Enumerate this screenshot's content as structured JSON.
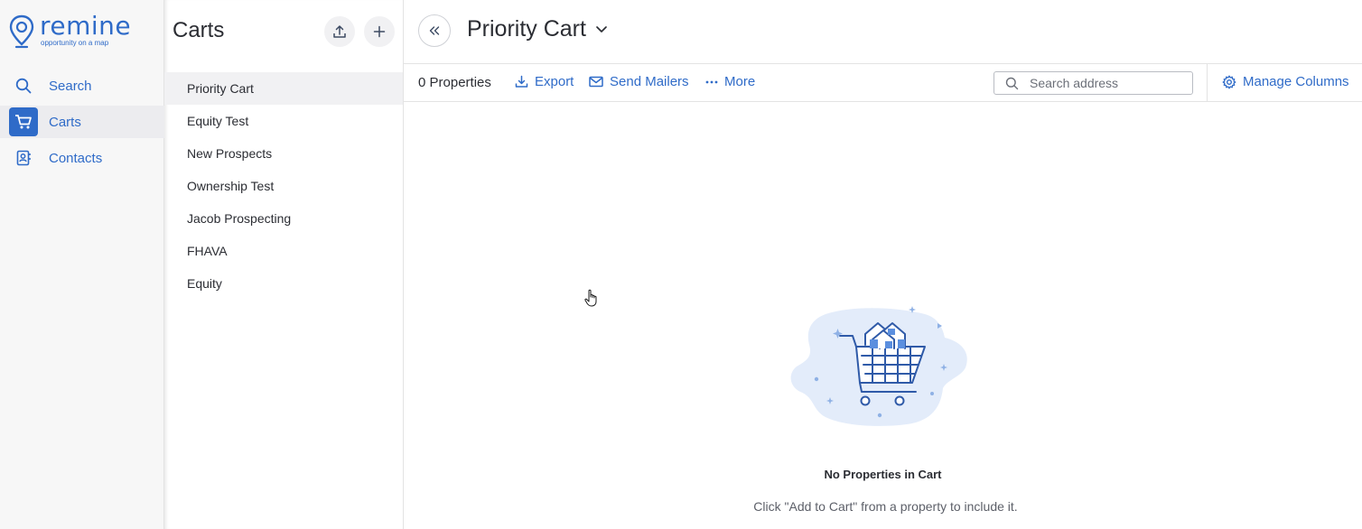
{
  "brand": {
    "name": "remine",
    "tagline": "opportunity on a map",
    "accent": "#2f6bc8"
  },
  "nav": {
    "items": [
      {
        "label": "Search",
        "icon": "search-icon",
        "active": false
      },
      {
        "label": "Carts",
        "icon": "cart-icon",
        "active": true
      },
      {
        "label": "Contacts",
        "icon": "contacts-icon",
        "active": false
      }
    ]
  },
  "carts": {
    "title": "Carts",
    "items": [
      "Priority Cart",
      "Equity Test",
      "New Prospects",
      "Ownership Test",
      "Jacob Prospecting",
      "FHAVA",
      "Equity"
    ],
    "selected": "Priority Cart"
  },
  "main": {
    "title": "Priority Cart",
    "property_count": "0 Properties",
    "actions": {
      "export": "Export",
      "send_mailers": "Send Mailers",
      "more": "More",
      "manage_columns": "Manage Columns"
    },
    "search": {
      "placeholder": "Search address",
      "value": ""
    },
    "empty": {
      "title": "No Properties in Cart",
      "subtitle": "Click \"Add to Cart\" from a property to include it."
    }
  }
}
